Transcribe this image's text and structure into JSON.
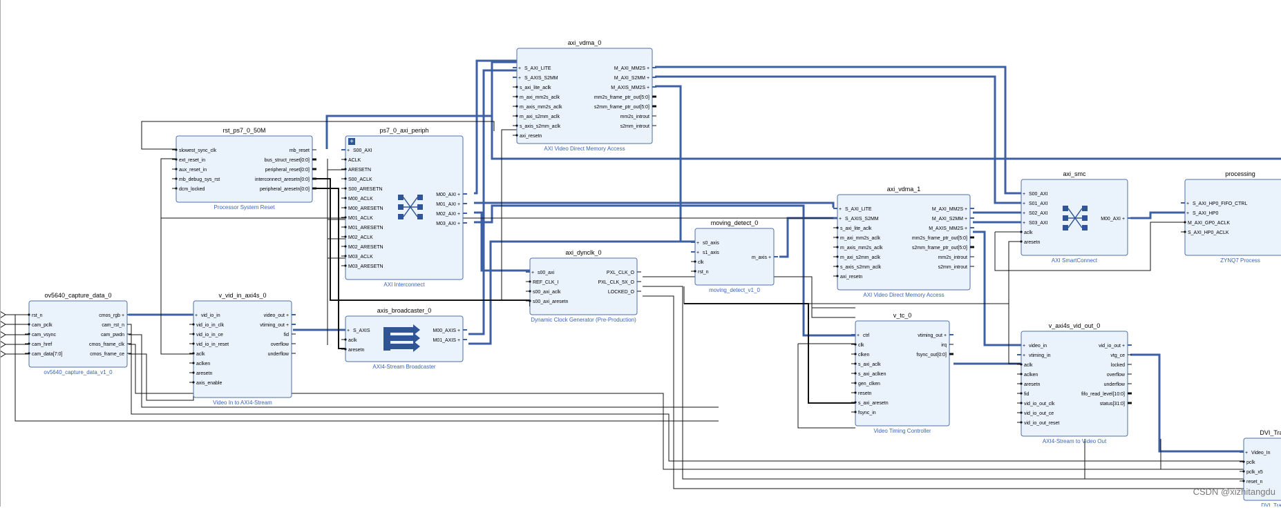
{
  "blocks": {
    "axi_vdma_0": {
      "title": "axi_vdma_0",
      "subtitle": "AXI Video Direct Memory Access",
      "left": [
        "S_AXI_LITE",
        "S_AXIS_S2MM",
        "s_axi_lite_aclk",
        "m_axi_mm2s_aclk",
        "m_axis_mm2s_aclk",
        "m_axi_s2mm_aclk",
        "s_axis_s2mm_aclk",
        "axi_resetn"
      ],
      "right": [
        "M_AXI_MM2S",
        "M_AXI_S2MM",
        "M_AXIS_MM2S",
        "mm2s_frame_ptr_out[5:0]",
        "s2mm_frame_ptr_out[5:0]",
        "mm2s_introut",
        "s2mm_introut"
      ]
    },
    "rst_ps7_0_50M": {
      "title": "rst_ps7_0_50M",
      "subtitle": "Processor System Reset",
      "left": [
        "slowest_sync_clk",
        "ext_reset_in",
        "aux_reset_in",
        "mb_debug_sys_rst",
        "dcm_locked"
      ],
      "right": [
        "mb_reset",
        "bus_struct_reset[0:0]",
        "peripheral_reset[0:0]",
        "interconnect_aresetn[0:0]",
        "peripheral_aresetn[0:0]"
      ]
    },
    "ps7_0_axi_periph": {
      "title": "ps7_0_axi_periph",
      "subtitle": "AXI Interconnect",
      "left": [
        "S00_AXI",
        "ACLK",
        "ARESETN",
        "S00_ACLK",
        "S00_ARESETN",
        "M00_ACLK",
        "M00_ARESETN",
        "M01_ACLK",
        "M01_ARESETN",
        "M02_ACLK",
        "M02_ARESETN",
        "M03_ACLK",
        "M03_ARESETN"
      ],
      "right": [
        "M00_AXI",
        "M01_AXI",
        "M02_AXI",
        "M03_AXI"
      ]
    },
    "ov5640_capture_data_0": {
      "title": "ov5640_capture_data_0",
      "subtitle": "ov5640_capture_data_v1_0",
      "left": [
        "rst_n",
        "cam_pclk",
        "cam_vsync",
        "cam_href",
        "cam_data[7:0]"
      ],
      "right": [
        "cmos_rgb",
        "cam_rst_n",
        "cam_pwdn",
        "cmos_frame_clk",
        "cmos_frame_ce"
      ]
    },
    "v_vid_in_axi4s_0": {
      "title": "v_vid_in_axi4s_0",
      "subtitle": "Video In to AXI4-Stream",
      "left": [
        "vid_io_in",
        "vid_io_in_clk",
        "vid_io_in_ce",
        "vid_io_in_reset",
        "aclk",
        "aclken",
        "aresetn",
        "axis_enable"
      ],
      "right": [
        "video_out",
        "vtiming_out",
        "fid",
        "overflow",
        "underflow"
      ]
    },
    "axis_broadcaster_0": {
      "title": "axis_broadcaster_0",
      "subtitle": "AXI4-Stream Broadcaster",
      "left": [
        "S_AXIS",
        "aclk",
        "aresetn"
      ],
      "right": [
        "M00_AXIS",
        "M01_AXIS"
      ]
    },
    "axi_dynclk_0": {
      "title": "axi_dynclk_0",
      "subtitle": "Dynamic Clock Generator (Pre-Production)",
      "left": [
        "s00_axi",
        "REF_CLK_I",
        "s00_axi_aclk",
        "s00_axi_aresetn"
      ],
      "right": [
        "PXL_CLK_O",
        "PXL_CLK_5X_O",
        "LOCKED_O"
      ]
    },
    "moving_detect_0": {
      "title": "moving_detect_0",
      "subtitle": "moving_detect_v1_0",
      "left": [
        "s0_axis",
        "s1_axis",
        "clk",
        "rst_n"
      ],
      "right": [
        "m_axis"
      ]
    },
    "axi_vdma_1": {
      "title": "axi_vdma_1",
      "subtitle": "AXI Video Direct Memory Access",
      "left": [
        "S_AXI_LITE",
        "S_AXIS_S2MM",
        "s_axi_lite_aclk",
        "m_axi_mm2s_aclk",
        "m_axis_mm2s_aclk",
        "m_axi_s2mm_aclk",
        "s_axis_s2mm_aclk",
        "axi_resetn"
      ],
      "right": [
        "M_AXI_MM2S",
        "M_AXI_S2MM",
        "M_AXIS_MM2S",
        "mm2s_frame_ptr_out[5:0]",
        "s2mm_frame_ptr_out[5:0]",
        "mm2s_introut",
        "s2mm_introut"
      ]
    },
    "axi_smc": {
      "title": "axi_smc",
      "subtitle": "AXI SmartConnect",
      "left": [
        "S00_AXI",
        "S01_AXI",
        "S02_AXI",
        "S03_AXI",
        "aclk",
        "aresetn"
      ],
      "right": [
        "M00_AXI"
      ]
    },
    "processing": {
      "title": "processing",
      "subtitle": "ZYNQ7 Process",
      "left": [
        "S_AXI_HP0_FIFO_CTRL",
        "S_AXI_HP0",
        "M_AXI_GP0_ACLK",
        "S_AXI_HP0_ACLK"
      ],
      "right": []
    },
    "v_tc_0": {
      "title": "v_tc_0",
      "subtitle": "Video Timing Controller",
      "left": [
        "ctrl",
        "clk",
        "clken",
        "s_axi_aclk",
        "s_axi_aclken",
        "gen_clken",
        "resetn",
        "s_axi_aresetn",
        "fsync_in"
      ],
      "right": [
        "vtiming_out",
        "irq",
        "fsync_out[0:0]"
      ]
    },
    "v_axi4s_vid_out_0": {
      "title": "v_axi4s_vid_out_0",
      "subtitle": "AXI4-Stream to Video Out",
      "left": [
        "video_in",
        "vtiming_in",
        "aclk",
        "aclken",
        "aresetn",
        "fid",
        "vid_io_out_clk",
        "vid_io_out_ce",
        "vid_io_out_reset"
      ],
      "right": [
        "vid_io_out",
        "vtg_ce",
        "locked",
        "overflow",
        "underflow",
        "fifo_read_level[10:0]",
        "status[31:0]"
      ]
    },
    "dvi_tra": {
      "title": "DVI_Tra",
      "subtitle": "DVI_Tra",
      "left": [
        "Video_In",
        "pclk",
        "pclk_x5",
        "reset_n"
      ],
      "right": []
    }
  },
  "watermark": "CSDN @xizhitangdu"
}
